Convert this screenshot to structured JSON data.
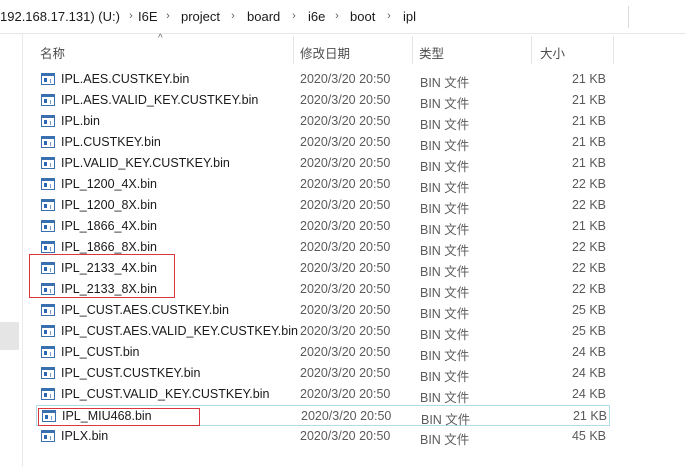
{
  "address": {
    "crumbs": [
      "192.168.17.131) (U:)",
      "I6E",
      "project",
      "board",
      "i6e",
      "boot",
      "ipl"
    ],
    "separator": "›"
  },
  "columns": {
    "name": "名称",
    "date": "修改日期",
    "type": "类型",
    "size": "大小",
    "sort_indicator": "^"
  },
  "files": [
    {
      "name": "IPL.AES.CUSTKEY.bin",
      "date": "2020/3/20 20:50",
      "type": "BIN 文件",
      "size": "21 KB"
    },
    {
      "name": "IPL.AES.VALID_KEY.CUSTKEY.bin",
      "date": "2020/3/20 20:50",
      "type": "BIN 文件",
      "size": "21 KB"
    },
    {
      "name": "IPL.bin",
      "date": "2020/3/20 20:50",
      "type": "BIN 文件",
      "size": "21 KB"
    },
    {
      "name": "IPL.CUSTKEY.bin",
      "date": "2020/3/20 20:50",
      "type": "BIN 文件",
      "size": "21 KB"
    },
    {
      "name": "IPL.VALID_KEY.CUSTKEY.bin",
      "date": "2020/3/20 20:50",
      "type": "BIN 文件",
      "size": "21 KB"
    },
    {
      "name": "IPL_1200_4X.bin",
      "date": "2020/3/20 20:50",
      "type": "BIN 文件",
      "size": "22 KB"
    },
    {
      "name": "IPL_1200_8X.bin",
      "date": "2020/3/20 20:50",
      "type": "BIN 文件",
      "size": "22 KB"
    },
    {
      "name": "IPL_1866_4X.bin",
      "date": "2020/3/20 20:50",
      "type": "BIN 文件",
      "size": "21 KB"
    },
    {
      "name": "IPL_1866_8X.bin",
      "date": "2020/3/20 20:50",
      "type": "BIN 文件",
      "size": "22 KB"
    },
    {
      "name": "IPL_2133_4X.bin",
      "date": "2020/3/20 20:50",
      "type": "BIN 文件",
      "size": "22 KB"
    },
    {
      "name": "IPL_2133_8X.bin",
      "date": "2020/3/20 20:50",
      "type": "BIN 文件",
      "size": "22 KB"
    },
    {
      "name": "IPL_CUST.AES.CUSTKEY.bin",
      "date": "2020/3/20 20:50",
      "type": "BIN 文件",
      "size": "25 KB"
    },
    {
      "name": "IPL_CUST.AES.VALID_KEY.CUSTKEY.bin",
      "date": "2020/3/20 20:50",
      "type": "BIN 文件",
      "size": "25 KB"
    },
    {
      "name": "IPL_CUST.bin",
      "date": "2020/3/20 20:50",
      "type": "BIN 文件",
      "size": "24 KB"
    },
    {
      "name": "IPL_CUST.CUSTKEY.bin",
      "date": "2020/3/20 20:50",
      "type": "BIN 文件",
      "size": "24 KB"
    },
    {
      "name": "IPL_CUST.VALID_KEY.CUSTKEY.bin",
      "date": "2020/3/20 20:50",
      "type": "BIN 文件",
      "size": "24 KB"
    },
    {
      "name": "IPL_MIU468.bin",
      "date": "2020/3/20 20:50",
      "type": "BIN 文件",
      "size": "21 KB"
    },
    {
      "name": "IPLX.bin",
      "date": "2020/3/20 20:50",
      "type": "BIN 文件",
      "size": "45 KB"
    }
  ],
  "selected_file": "IPL_MIU468.bin",
  "icon": "bin-file-icon",
  "colors": {
    "annotation": "#d9363e",
    "selection_border": "#b0dcec"
  }
}
